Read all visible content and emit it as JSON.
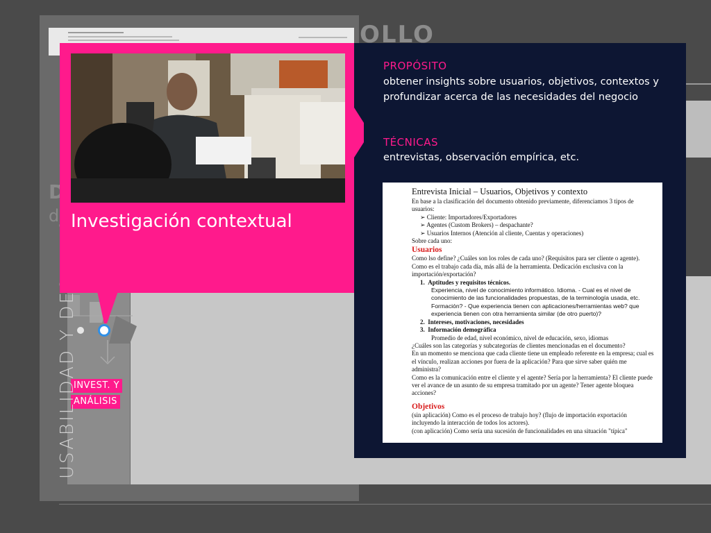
{
  "background": {
    "heading_fragment": "OLLO",
    "side_letters": [
      "D",
      "d"
    ],
    "vertical_title": "USABILIDAD Y DESARROLLO"
  },
  "timeline": {
    "phase_label_lines": [
      "INVEST. Y",
      "ANÁLISIS"
    ]
  },
  "callout": {
    "title": "Investigación contextual",
    "photo_icon": "office-photo"
  },
  "panel": {
    "purpose_title": "PROPÓSITO",
    "purpose_text": "obtener insights sobre usuarios, objetivos, contextos y profundizar acerca de las necesidades del negocio",
    "techniques_title": "TÉCNICAS",
    "techniques_text": "entrevistas, observación empírica, etc."
  },
  "document": {
    "title": "Entrevista Inicial – Usuarios, Objetivos y contexto",
    "intro": "En base a la clasificación del documento obtenido previamente, diferenciamos 3 tipos de usuarios:",
    "user_types": [
      "Cliente: Importadores/Exportadores",
      "Agentes (Custom Brokers) – despachante?",
      "Usuarios Internos (Atención al cliente, Cuentas y operaciones)"
    ],
    "about_each": "Sobre cada uno:",
    "section_users": "Usuarios",
    "q1": "Como lso define? ¿Cuáles son los roles de cada uno? (Requisitos para ser cliente o agente).",
    "q2": "Como es el trabajo cada día, más allá de la herramienta. Dedicación exclusiva con la importación/exportación?",
    "item1_title": "Aptitudes y requisitos técnicos.",
    "item1_text": "Experiencia, nivel de conocimiento informático. Idioma. - Cual es el nivel de conocimiento de las funcionalidades propuestas, de la terminología usada, etc. Formación? - Que experiencia tienen con aplicaciones/herramientas web? que experiencia tienen con otra herramienta similar (de otro puerto)?",
    "item2_title": "Intereses, motivaciones, necesidades",
    "item3_title": "Información demográfica",
    "item3_text": "Promedio de edad, nivel económico, nivel de educación, sexo, idiomas",
    "q3": "¿Cuáles son las categorías y subcategorías de clientes mencionadas en el documento?",
    "q4": "En un momento se menciona que cada cliente tiene un empleado referente en la empresa; cual es el vínculo, realizan acciones por fuera de la aplicación? Para que sirve saber quién me administra?",
    "q5": "Como es la comunicación entre el cliente y el agente? Sería por la herramienta? El cliente puede ver el avance de un asunto de su empresa tramitado por un agente? Tener agente bloquea acciones?",
    "section_goals": "Objetivos",
    "g1": "(sin aplicación) Como es el proceso de trabajo hoy? (flujo de importación exportación incluyendo la interacción de todos los actores).",
    "g2": "(con aplicación) Como sería una sucesión de funcionalidades en una situación \"típica\""
  },
  "colors": {
    "accent_pink": "#ff1a8c",
    "panel_navy": "#0d1633",
    "timeline_blue": "#2f8fe6"
  }
}
